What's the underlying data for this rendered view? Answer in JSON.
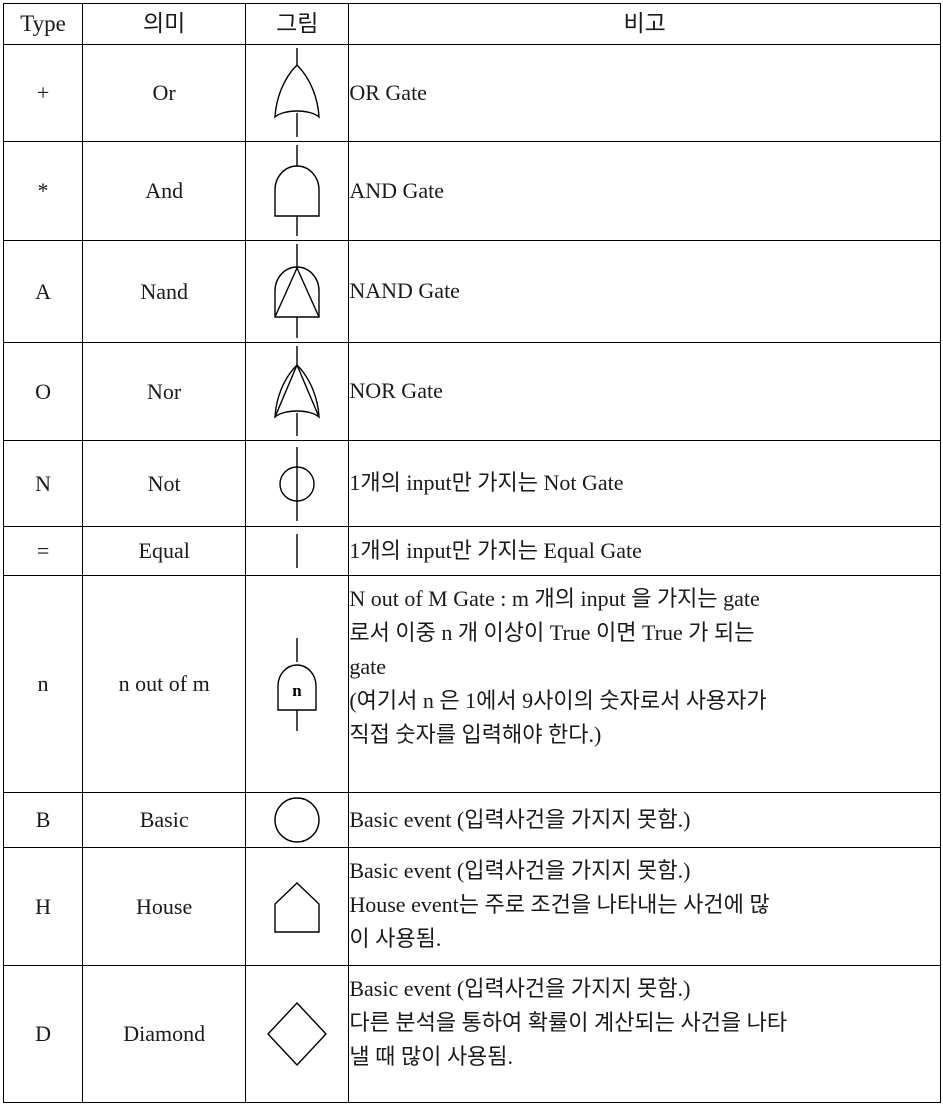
{
  "table": {
    "headers": {
      "type": "Type",
      "meaning": "의미",
      "figure": "그림",
      "remark": "비고"
    },
    "rows": [
      {
        "type": "+",
        "meaning": "Or",
        "figure_icon": "or-gate-symbol",
        "remark_lines": [
          "OR Gate"
        ]
      },
      {
        "type": "*",
        "meaning": "And",
        "figure_icon": "and-gate-symbol",
        "remark_lines": [
          "AND Gate"
        ]
      },
      {
        "type": "A",
        "meaning": "Nand",
        "figure_icon": "nand-gate-symbol",
        "remark_lines": [
          "NAND Gate"
        ]
      },
      {
        "type": "O",
        "meaning": "Nor",
        "figure_icon": "nor-gate-symbol",
        "remark_lines": [
          "NOR Gate"
        ]
      },
      {
        "type": "N",
        "meaning": "Not",
        "figure_icon": "not-gate-symbol",
        "remark_lines": [
          "1개의 input만 가지는 Not Gate"
        ]
      },
      {
        "type": "=",
        "meaning": "Equal",
        "figure_icon": "equal-gate-symbol",
        "remark_lines": [
          "1개의 input만 가지는 Equal Gate"
        ]
      },
      {
        "type": "n",
        "meaning": "n out of m",
        "figure_icon": "n-out-of-m-gate-symbol",
        "figure_label": "n",
        "remark_lines": [
          "N out of M Gate : m 개의 input 을 가지는 gate",
          "로서 이중 n 개 이상이  True 이면 True 가 되는",
          "gate",
          "(여기서 n 은 1에서 9사이의 숫자로서 사용자가",
          "직접 숫자를 입력해야 한다.)"
        ]
      },
      {
        "type": "B",
        "meaning": "Basic",
        "figure_icon": "basic-event-circle-symbol",
        "remark_lines": [
          "Basic event (입력사건을 가지지 못함.)"
        ]
      },
      {
        "type": "H",
        "meaning": "House",
        "figure_icon": "house-event-symbol",
        "remark_lines": [
          "Basic event (입력사건을 가지지 못함.)",
          "House event는 주로 조건을 나타내는 사건에 많",
          "이 사용됨."
        ]
      },
      {
        "type": "D",
        "meaning": "Diamond",
        "figure_icon": "diamond-event-symbol",
        "remark_lines": [
          "Basic event (입력사건을 가지지 못함.)",
          "다른 분석을 통하여 확률이 계산되는 사건을 나타",
          "낼 때 많이 사용됨."
        ]
      }
    ]
  },
  "colors": {
    "border": "#000000",
    "text": "#1a1a1a",
    "background": "#ffffff"
  }
}
